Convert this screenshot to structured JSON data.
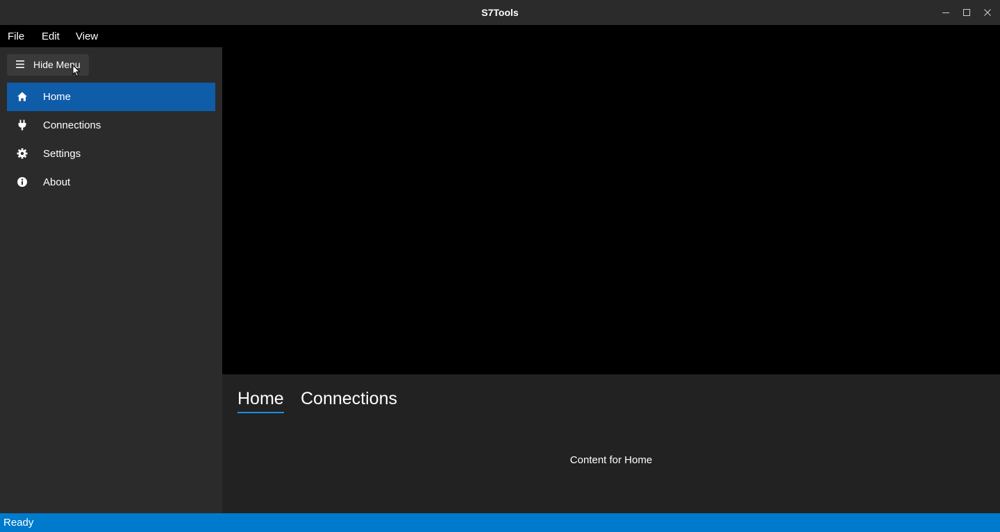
{
  "window": {
    "title": "S7Tools"
  },
  "menubar": {
    "items": [
      "File",
      "Edit",
      "View"
    ]
  },
  "sidebar": {
    "toggle_label": "Hide Menu",
    "items": [
      {
        "label": "Home",
        "icon": "home-icon",
        "active": true
      },
      {
        "label": "Connections",
        "icon": "plug-icon",
        "active": false
      },
      {
        "label": "Settings",
        "icon": "gear-icon",
        "active": false
      },
      {
        "label": "About",
        "icon": "info-icon",
        "active": false
      }
    ]
  },
  "tabs": {
    "items": [
      "Home",
      "Connections"
    ],
    "selected": "Home",
    "content": "Content for Home"
  },
  "statusbar": {
    "text": "Ready"
  },
  "colors": {
    "accent": "#0f5ca8",
    "statusbar": "#007acc",
    "tab_underline": "#1c8fe0"
  }
}
